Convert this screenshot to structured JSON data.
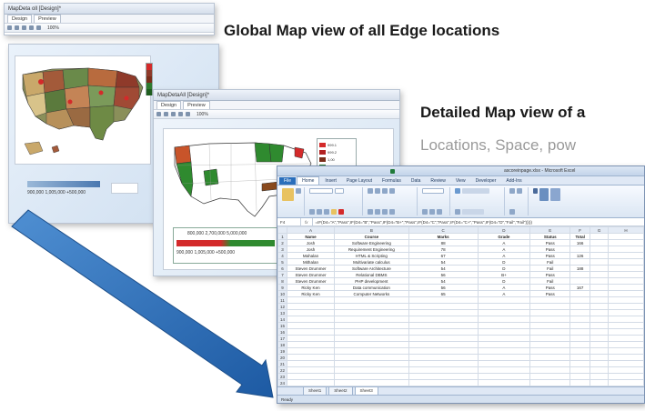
{
  "headings": {
    "global": "Global Map view of all Edge locations",
    "detailed": "Detailed Map view of a",
    "sub": "Locations, Space, pow"
  },
  "shot1": {
    "title": "MapDeta oll [Design]*",
    "tabs": [
      "Design",
      "Preview"
    ],
    "zoom": "100%"
  },
  "shot2": {
    "title": "MapDetail [Design]*",
    "tabs": [
      "Design",
      "Preview"
    ],
    "zoom": "100%",
    "scale_label": "900,000 1,005,000 +500,000"
  },
  "shot3": {
    "title": "MapDetaAll [Design]*",
    "tabs": [
      "Design",
      "Preview"
    ],
    "zoom": "100%",
    "scale_top": "800,000  2,700,000  5,000,000",
    "scale_bottom": "900,000  1,005,000  +500,000",
    "legend": [
      {
        "label": "999.1",
        "color": "#d42a2a"
      },
      {
        "label": "999.2",
        "color": "#b22222"
      },
      {
        "label": "1,00",
        "color": "#7a2e1a"
      },
      {
        "label": "1,00",
        "color": "#2f7a2f"
      },
      {
        "label": "1,05",
        "color": "#1f5e1f"
      }
    ]
  },
  "excel": {
    "title": "ascoreinpage.xlsx - Microsoft Excel",
    "tabs": [
      "File",
      "Home",
      "Insert",
      "Page Layout",
      "Formulas",
      "Data",
      "Review",
      "View",
      "Developer",
      "Add-Ins"
    ],
    "name_box": "F4",
    "fx": "fx",
    "formula": "=IF(D4=\"A\",\"Pass\",IF(D4=\"B\",\"Pass\",IF(D4=\"B+\",\"Pass\",IF(D4=\"C\",\"Pass\",IF(D4=\"C+\",\"Pass\",IF(D4=\"D\",\"Fail\",\"Fail\")))))",
    "columns": [
      "A",
      "B",
      "C",
      "D",
      "E",
      "F",
      "G",
      "H"
    ],
    "headers": [
      "Name",
      "Course",
      "Marks",
      "Grade",
      "Status",
      "Total"
    ],
    "rows": [
      [
        "Josh",
        "Software Engineering",
        "88",
        "A",
        "Pass",
        "166"
      ],
      [
        "Josh",
        "Requirement Engineering",
        "78",
        "A",
        "Pass",
        ""
      ],
      [
        "Mahalan",
        "HTML & Scripting",
        "67",
        "A",
        "Pass",
        "126"
      ],
      [
        "Mithalan",
        "Multivariate calculus",
        "54",
        "D",
        "Fail",
        ""
      ],
      [
        "Steven Drummer",
        "Software Architecture",
        "54",
        "D",
        "Fail",
        "188"
      ],
      [
        "Steven Drummer",
        "Relational DBMS",
        "56",
        "B+",
        "Pass",
        ""
      ],
      [
        "Steven Drummer",
        "PHP development",
        "54",
        "D",
        "Fail",
        ""
      ],
      [
        "Ricky Ken",
        "Data communication",
        "56",
        "A",
        "Pass",
        "167"
      ],
      [
        "Ricky Ken",
        "Computer Networks",
        "65",
        "A",
        "Pass",
        ""
      ]
    ],
    "sheets": [
      "Sheet1",
      "Sheet2",
      "Sheet3"
    ],
    "status": "Ready"
  },
  "colors": {
    "arrow": "#2e6fb6",
    "arrow_dark": "#1d4f8a"
  }
}
